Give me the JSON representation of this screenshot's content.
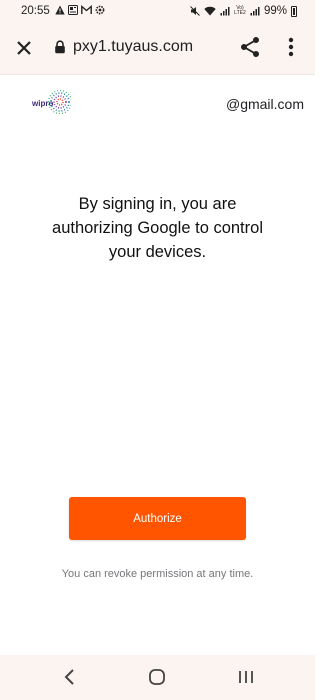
{
  "status_bar": {
    "time": "20:55",
    "battery": "99%",
    "left_icons": [
      "alert-icon",
      "news-icon",
      "gmail-icon",
      "settings-gear-icon"
    ],
    "right_icons": [
      "mute-icon",
      "wifi-icon",
      "signal-icon",
      "volte-icon",
      "signal-icon",
      "battery-icon"
    ],
    "volte_label": "Vo) LTE2"
  },
  "toolbar": {
    "url": "pxy1.tuyaus.com",
    "close_icon": "close-icon",
    "lock_icon": "lock-icon",
    "share_icon": "share-icon",
    "menu_icon": "more-vert-icon"
  },
  "header": {
    "logo_text": "wipro",
    "account": "@gmail.com"
  },
  "main": {
    "message_line1": "By signing in, you are",
    "message_line2": "authorizing Google to control",
    "message_line3": "your devices.",
    "authorize_label": "Authorize",
    "revoke_note": "You can revoke permission at any time."
  },
  "colors": {
    "accent": "#ff5500",
    "chrome_bg": "#fcf4f1",
    "note_text": "#77767a"
  },
  "nav_bar": {
    "back_icon": "back-icon",
    "home_icon": "home-icon",
    "recents_icon": "recents-icon"
  }
}
